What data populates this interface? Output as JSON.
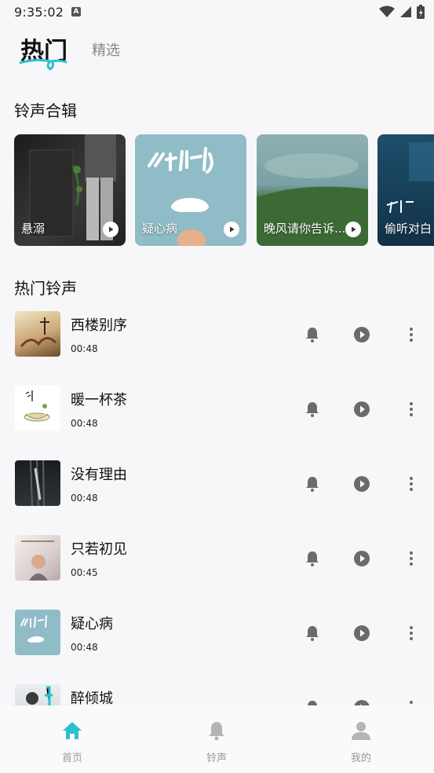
{
  "status": {
    "time": "9:35:02",
    "notification_glyph": "A"
  },
  "tabs": {
    "hot": "热门",
    "selected": "精选"
  },
  "sections": {
    "albums_title": "铃声合辑",
    "hot_title": "热门铃声"
  },
  "albums": [
    {
      "label": "悬溺"
    },
    {
      "label": "疑心病"
    },
    {
      "label": "晚风请你告诉..."
    },
    {
      "label": "偷听对白"
    }
  ],
  "songs": [
    {
      "title": "西楼别序",
      "duration": "00:48"
    },
    {
      "title": "暖一杯茶",
      "duration": "00:48"
    },
    {
      "title": "没有理由",
      "duration": "00:48"
    },
    {
      "title": "只若初见",
      "duration": "00:45"
    },
    {
      "title": "疑心病",
      "duration": "00:48"
    },
    {
      "title": "醉倾城",
      "duration": ""
    }
  ],
  "nav": {
    "home": "首页",
    "ringtone": "铃声",
    "mine": "我的"
  },
  "colors": {
    "accent": "#2bbfd4",
    "icon_gray": "#6b6b6b",
    "inactive_nav": "#b5b5b5"
  }
}
